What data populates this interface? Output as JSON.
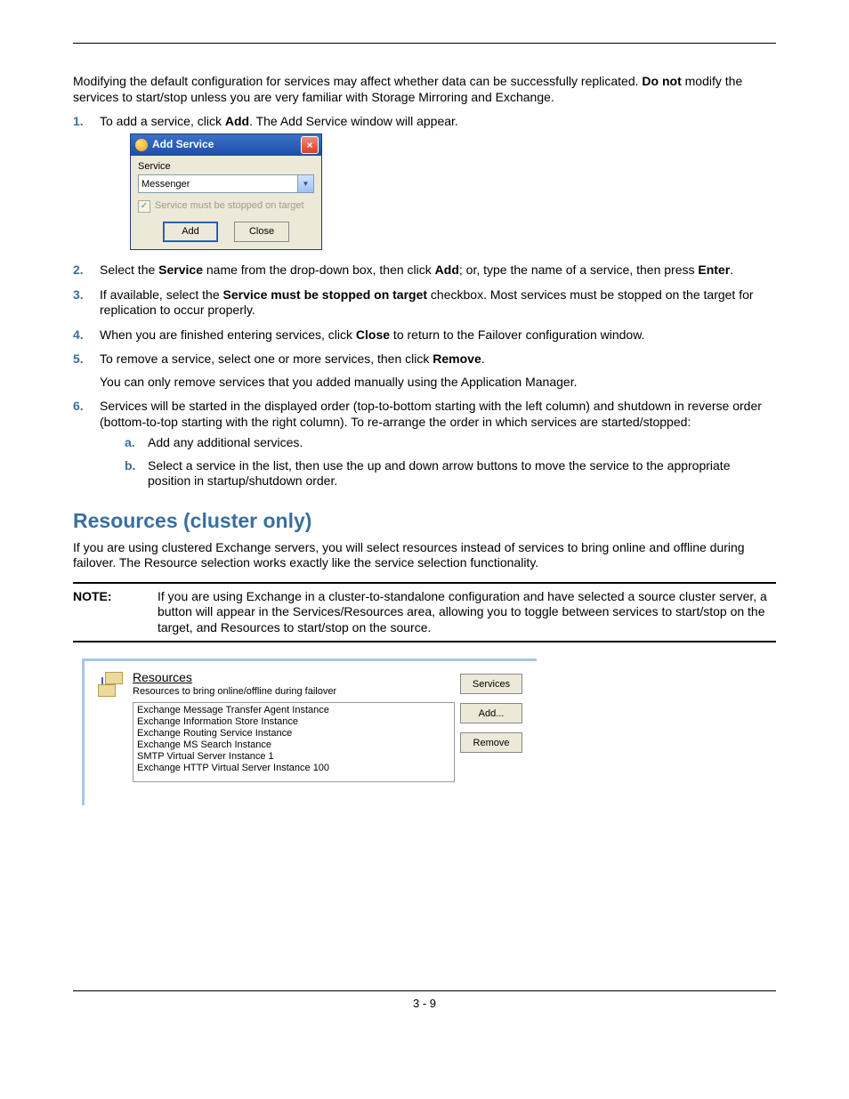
{
  "intro": {
    "p1a": "Modifying the default configuration for services may affect whether data can be successfully replicated. ",
    "p1b_bold": "Do not",
    "p1c": " modify the services to start/stop unless you are very familiar with Storage Mirroring and Exchange."
  },
  "steps": {
    "s1": {
      "n": "1.",
      "a": "To add a service, click ",
      "b": "Add",
      "c": ". The Add Service window will appear."
    },
    "s2": {
      "n": "2.",
      "a": "Select the ",
      "b": "Service",
      "c": " name from the drop-down box, then click ",
      "d": "Add",
      "e": "; or, type the name of a service, then press ",
      "f": "Enter",
      "g": "."
    },
    "s3": {
      "n": "3.",
      "a": "If available, select the ",
      "b": "Service must be stopped on target",
      "c": " checkbox. Most services must be stopped on the target for replication to occur properly."
    },
    "s4": {
      "n": "4.",
      "a": "When you are finished entering services, click ",
      "b": "Close",
      "c": " to return to the Failover configuration window."
    },
    "s5": {
      "n": "5.",
      "a": "To remove a service, select one or more services, then click ",
      "b": "Remove",
      "c": ".",
      "extra": "You can only remove services that you added manually using the Application Manager."
    },
    "s6": {
      "n": "6.",
      "a": "Services will be started in the displayed order (top-to-bottom starting with the left column) and shutdown in reverse order (bottom-to-top starting with the right column). To re-arrange the order in which services are started/stopped:",
      "suba": {
        "n": "a.",
        "t": "Add any additional services."
      },
      "subb": {
        "n": "b.",
        "t": "Select a service in the list, then use the up and down arrow buttons to move the service to the appropriate position in startup/shutdown order."
      }
    }
  },
  "dialog": {
    "title": "Add Service",
    "service_label": "Service",
    "service_value": "Messenger",
    "checkbox_label": "Service must be stopped on target",
    "add_btn": "Add",
    "close_btn": "Close",
    "close_x": "×"
  },
  "section_heading": "Resources (cluster only)",
  "section_para": "If you are using clustered Exchange servers, you will select resources instead of services to bring online and offline during failover. The Resource selection works exactly like the service selection functionality.",
  "note": {
    "label": "NOTE:",
    "body": "If you are using Exchange in a cluster-to-standalone configuration and have selected a source cluster server, a button will appear in the Services/Resources area, allowing you to toggle between services to start/stop on the target, and Resources to start/stop on the source."
  },
  "resources_panel": {
    "title": "Resources",
    "subtitle": "Resources to bring online/offline during failover",
    "items": [
      "Exchange Message Transfer Agent Instance",
      "Exchange Information Store Instance",
      "Exchange Routing Service Instance",
      "Exchange MS Search Instance",
      "SMTP Virtual Server Instance 1",
      "Exchange HTTP Virtual Server Instance 100"
    ],
    "btn_services": "Services",
    "btn_add": "Add...",
    "btn_remove": "Remove"
  },
  "pagenum": "3 - 9"
}
